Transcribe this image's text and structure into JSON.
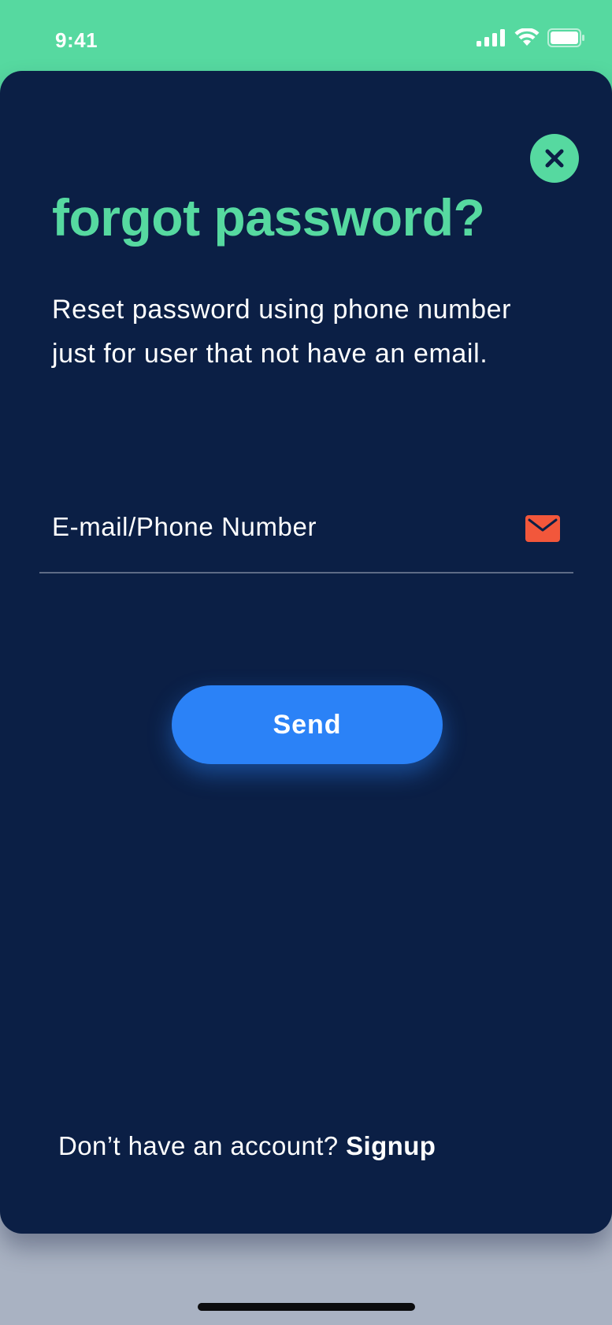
{
  "status_bar": {
    "time": "9:41",
    "icons": [
      "cellular-signal-icon",
      "wifi-icon",
      "battery-icon"
    ]
  },
  "colors": {
    "accent": "#56d9a0",
    "sheet_background": "#0b1f45",
    "button": "#2b82f7",
    "mail_icon": "#f2573b"
  },
  "header": {
    "close_icon": "close-icon",
    "title": "forgot password?"
  },
  "description": {
    "line1": "Reset password using phone number",
    "line2": "just for user that not have an email."
  },
  "form": {
    "field_label": "E-mail/Phone Number",
    "field_icon": "mail-icon",
    "send_label": "Send"
  },
  "footer": {
    "prompt": "Don’t have an account? ",
    "signup_label": "Signup"
  }
}
